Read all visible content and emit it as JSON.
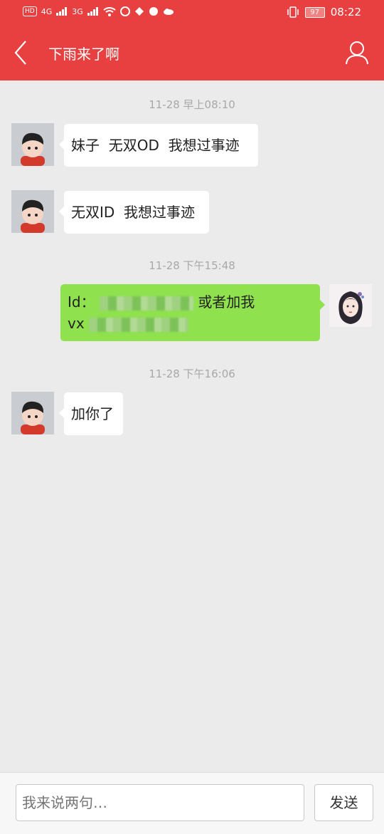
{
  "status_bar": {
    "left_badges": [
      "HD",
      "4G",
      "3G"
    ],
    "battery": "97",
    "time": "08:22"
  },
  "header": {
    "title": "下雨来了啊",
    "back_icon": "chevron-left-icon",
    "profile_icon": "person-icon",
    "color": "#e84040"
  },
  "messages": [
    {
      "time": "11-28 早上08:10"
    },
    {
      "from": "other",
      "text": "妹子  无双OD  我想过事迹"
    },
    {
      "from": "other",
      "text": "无双ID  我想过事迹"
    },
    {
      "time": "11-28 下午15:48"
    },
    {
      "from": "me",
      "line1_prefix": "Id：",
      "line1_suffix": "或者加我",
      "line2_prefix": "vx"
    },
    {
      "time": "11-28 下午16:06"
    },
    {
      "from": "other",
      "text": "加你了"
    }
  ],
  "composer": {
    "placeholder": "我来说两句…",
    "send_label": "发送"
  }
}
